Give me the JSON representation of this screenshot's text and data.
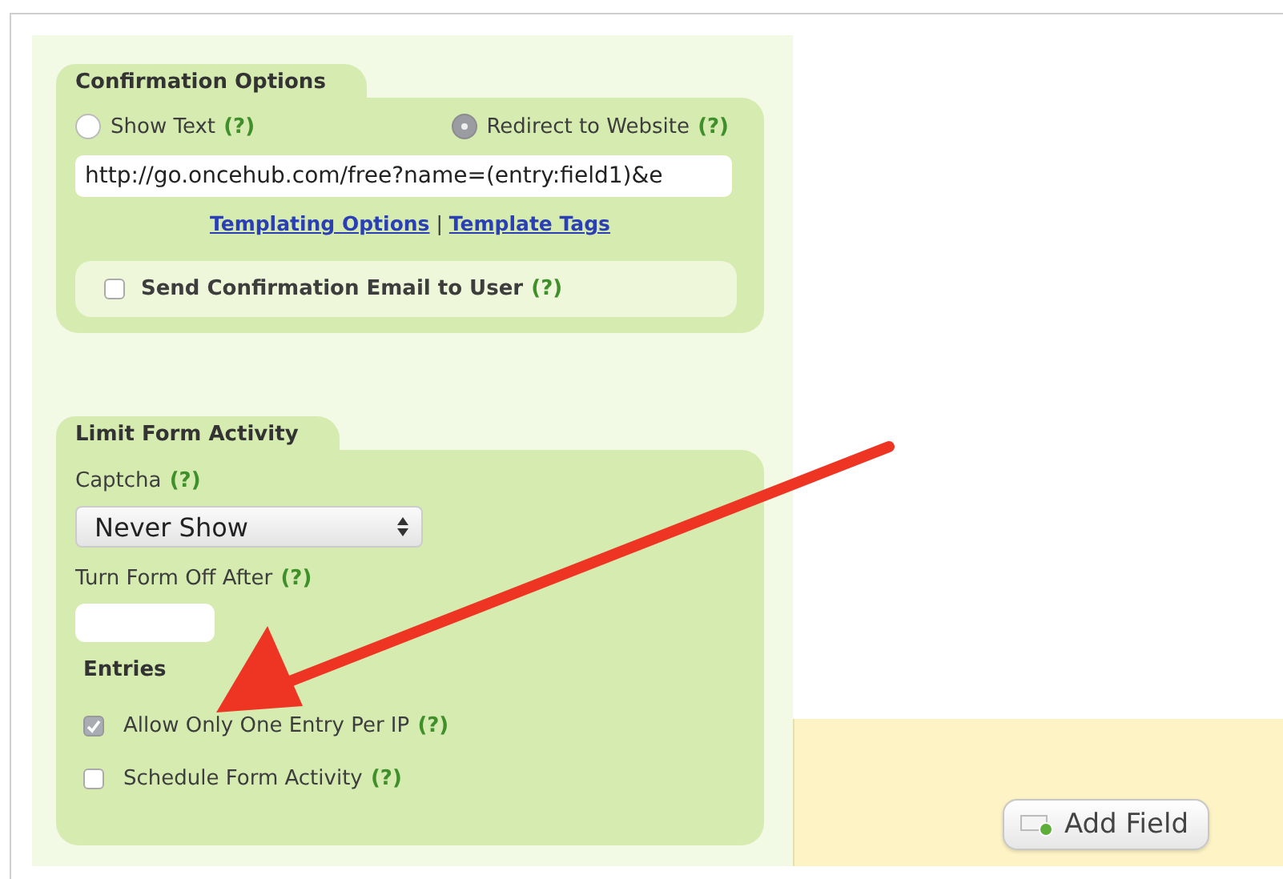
{
  "confirmation_options": {
    "title": "Confirmation Options",
    "radios": [
      {
        "label": "Show Text",
        "help": "(?)",
        "selected": false
      },
      {
        "label": "Redirect to Website",
        "help": "(?)",
        "selected": true
      }
    ],
    "url_field": {
      "value": "http://go.oncehub.com/free?name=(entry:field1)&e"
    },
    "links": [
      "Templating Options",
      "Template Tags"
    ],
    "separator": "|",
    "email_option": {
      "label": "Send Confirmation Email to User",
      "help": "(?)",
      "checked": false
    }
  },
  "limit_form_activity": {
    "title": "Limit Form Activity",
    "captcha": {
      "label": "Captcha",
      "help": "(?)",
      "value": "Never Show"
    },
    "turn_off": {
      "label": "Turn Form Off After",
      "help": "(?)"
    },
    "entries_label": "Entries",
    "options": [
      {
        "label": "Allow Only One Entry Per IP",
        "help": "(?)",
        "checked": true
      },
      {
        "label": "Schedule Form Activity",
        "help": "(?)",
        "checked": false
      }
    ]
  },
  "add_field_button": {
    "label": "Add Field"
  }
}
